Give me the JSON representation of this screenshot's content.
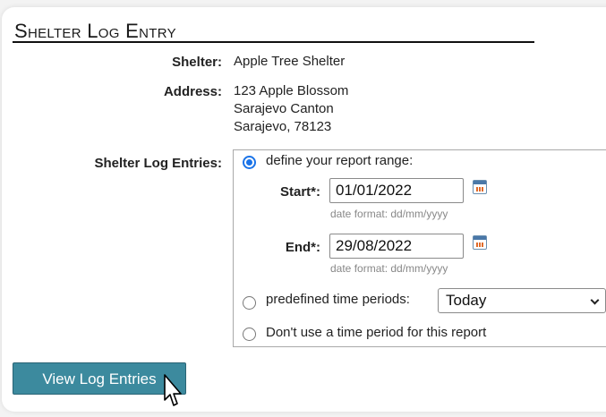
{
  "page": {
    "title": "Shelter Log Entry"
  },
  "details": {
    "shelter_label": "Shelter:",
    "shelter_value": "Apple Tree Shelter",
    "address_label": "Address:",
    "address_lines": [
      "123 Apple Blossom",
      "Sarajevo Canton",
      "Sarajevo, 78123"
    ]
  },
  "entries": {
    "label": "Shelter Log Entries:",
    "option_range": "define your report range:",
    "start_label": "Start*:",
    "start_value": "01/01/2022",
    "end_label": "End*:",
    "end_value": "29/08/2022",
    "date_hint": "date format: dd/mm/yyyy",
    "option_predefined": "predefined time periods:",
    "predefined_selected": "Today",
    "option_none": "Don't use a time period for this report",
    "selected_option": "define your report range"
  },
  "actions": {
    "view_button": "View Log Entries"
  },
  "colors": {
    "button_bg": "#3c8a9e",
    "radio_accent": "#1a73e8"
  },
  "icons": [
    "calendar-icon",
    "chevron-down-icon",
    "mouse-pointer-icon"
  ]
}
